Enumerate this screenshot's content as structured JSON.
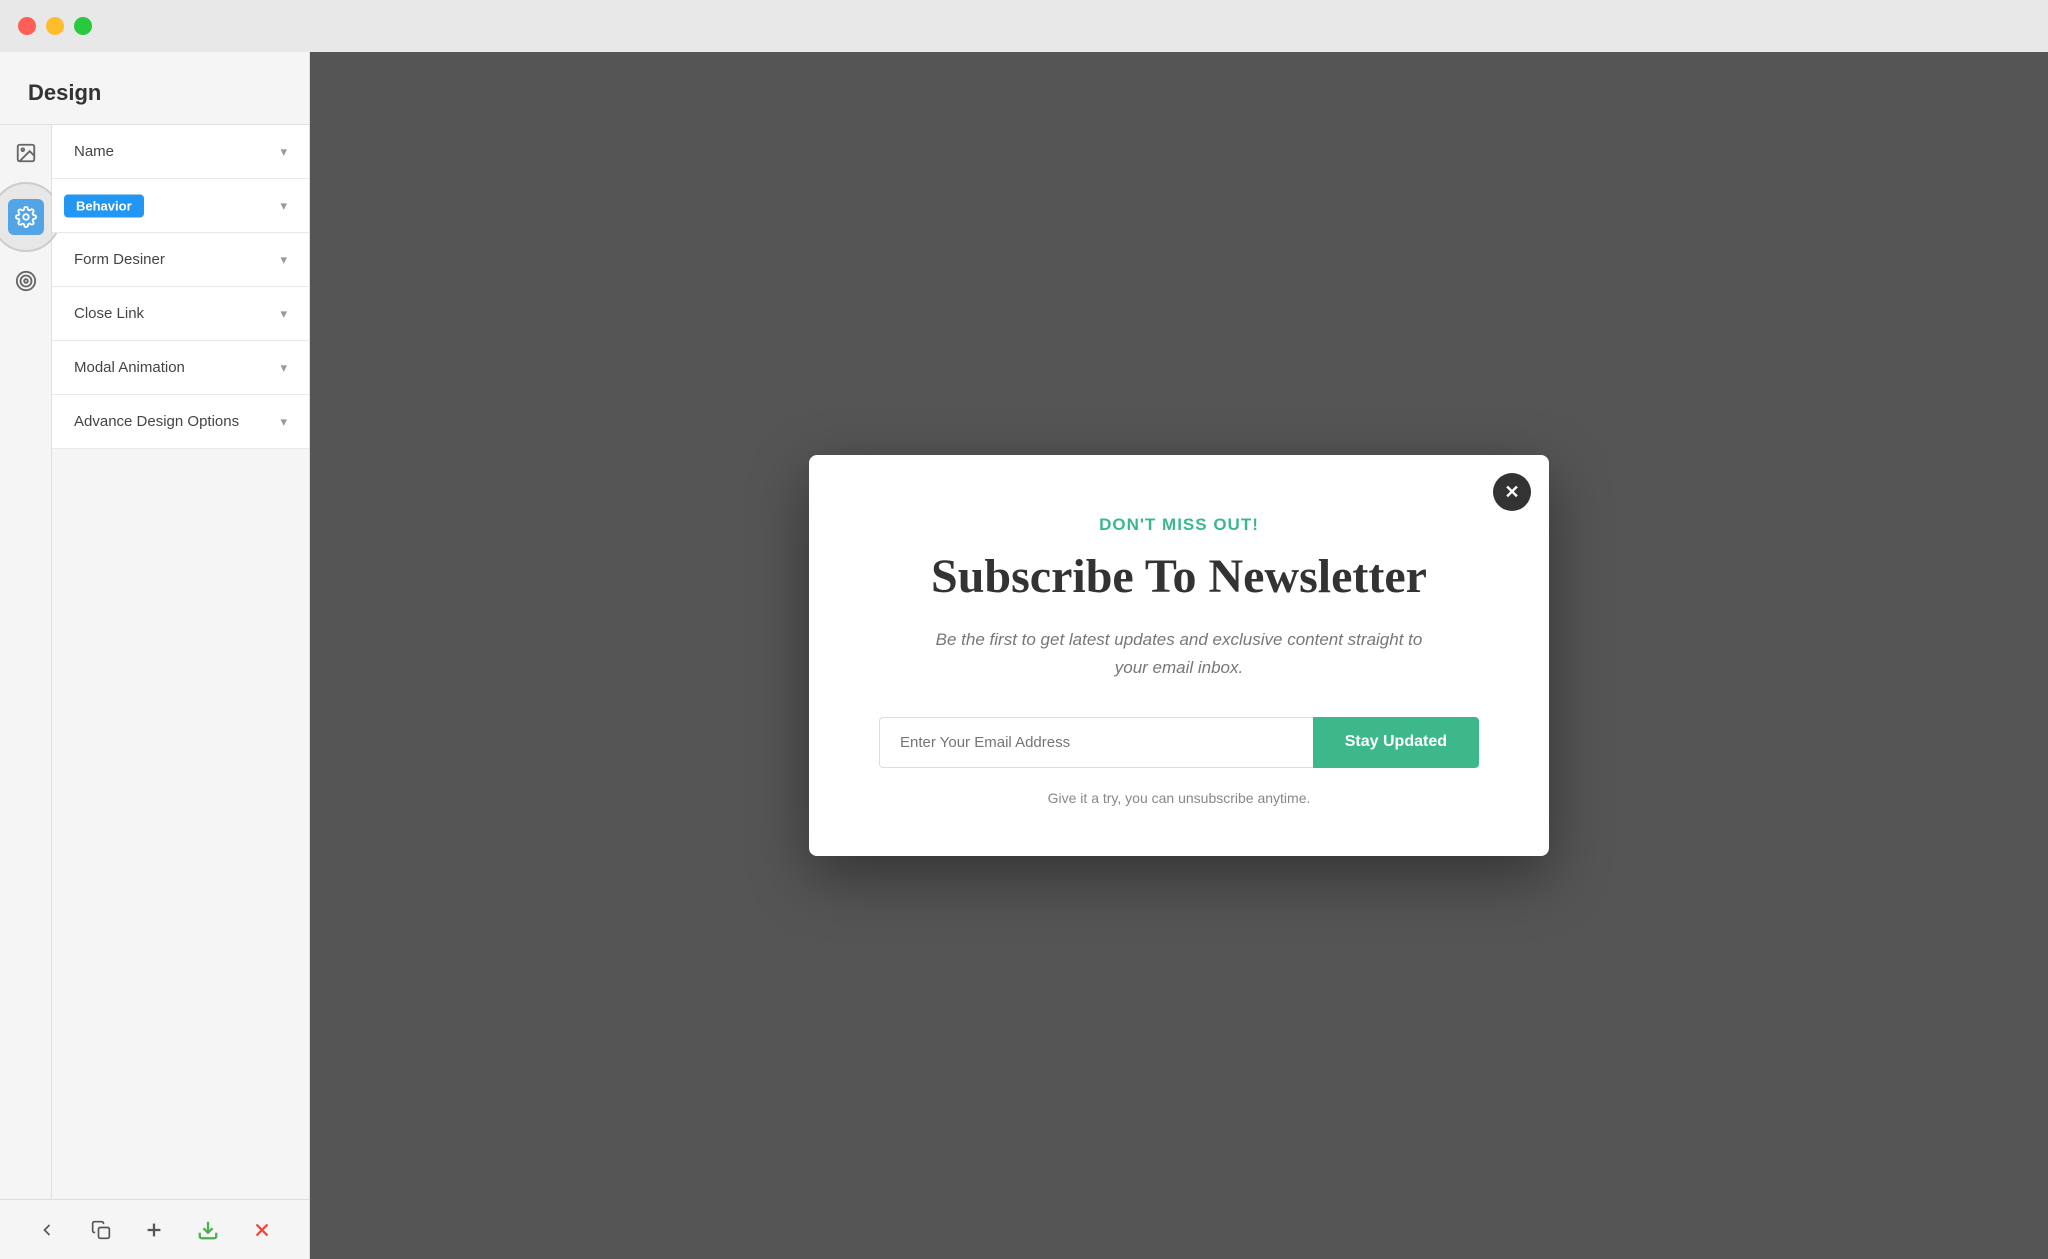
{
  "titlebar": {
    "traffic_lights": [
      "close",
      "minimize",
      "maximize"
    ]
  },
  "sidebar": {
    "title": "Design",
    "menu_items": [
      {
        "id": "name",
        "label": "Name"
      },
      {
        "id": "behavior",
        "label": "Behavior"
      },
      {
        "id": "form-designer",
        "label": "Form Desiner"
      },
      {
        "id": "close-link",
        "label": "Close Link"
      },
      {
        "id": "modal-animation",
        "label": "Modal Animation"
      },
      {
        "id": "advance-design-options",
        "label": "Advance Design Options"
      }
    ],
    "icons": [
      {
        "id": "image-icon",
        "symbol": "🖼",
        "label": "image"
      },
      {
        "id": "gear-icon",
        "symbol": "⚙",
        "label": "settings",
        "active": true
      },
      {
        "id": "target-icon",
        "symbol": "◎",
        "label": "target"
      }
    ]
  },
  "behavior_badge": "Behavior",
  "bottom_toolbar": {
    "buttons": [
      {
        "id": "back-button",
        "symbol": "←",
        "color": "normal"
      },
      {
        "id": "copy-button",
        "symbol": "⧉",
        "color": "normal"
      },
      {
        "id": "add-button",
        "symbol": "+",
        "color": "normal"
      },
      {
        "id": "download-button",
        "symbol": "⬇",
        "color": "green"
      },
      {
        "id": "close-button",
        "symbol": "✕",
        "color": "red"
      }
    ]
  },
  "modal": {
    "tagline": "DON'T MISS OUT!",
    "title": "Subscribe To Newsletter",
    "subtitle": "Be the first to get latest updates and exclusive content straight to your email inbox.",
    "email_placeholder": "Enter Your Email Address",
    "submit_label": "Stay Updated",
    "footer_text": "Give it a try, you can unsubscribe anytime.",
    "close_symbol": "✕"
  },
  "colors": {
    "teal": "#3db88a",
    "dark_bg": "#555555",
    "sidebar_bg": "#f5f5f5"
  }
}
